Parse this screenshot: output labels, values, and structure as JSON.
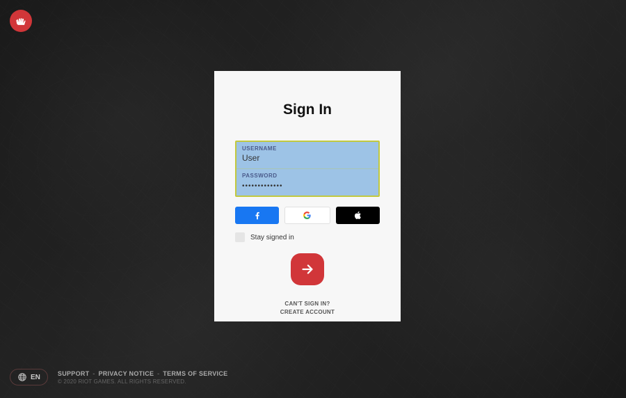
{
  "brand_color": "#d13639",
  "card": {
    "title": "Sign In",
    "username": {
      "label": "USERNAME",
      "value": "User"
    },
    "password": {
      "label": "PASSWORD",
      "value": "•••••••••••••"
    },
    "stay_signed_in": "Stay signed in",
    "cant_sign_in": "CAN'T SIGN IN?",
    "create_account": "CREATE ACCOUNT"
  },
  "social": {
    "facebook": "facebook-icon",
    "google": "google-icon",
    "apple": "apple-icon"
  },
  "footer": {
    "language": "EN",
    "support": "SUPPORT",
    "privacy": "PRIVACY NOTICE",
    "terms": "TERMS OF SERVICE",
    "sep": "-",
    "copyright": "© 2020 RIOT GAMES. ALL RIGHTS RESERVED."
  }
}
